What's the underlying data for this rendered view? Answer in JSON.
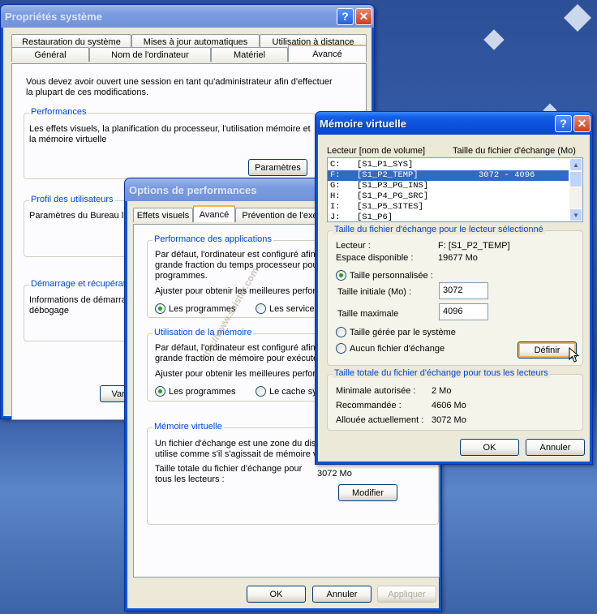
{
  "sys": {
    "title": "Propriétés système",
    "tabs_back": [
      "Restauration du système",
      "Mises à jour automatiques",
      "Utilisation à distance"
    ],
    "tabs_front": [
      "Général",
      "Nom de l'ordinateur",
      "Matériel",
      "Avancé"
    ],
    "intro": [
      "Vous devez avoir ouvert une session en tant qu'administrateur afin d'effectuer",
      "la plupart de ces modifications."
    ],
    "perf_label": "Performances",
    "perf_text": [
      "Les effets visuels, la planification du processeur, l'utilisation mémoire et",
      "la mémoire virtuelle"
    ],
    "perf_btn": "Paramètres",
    "profile_label": "Profil des utilisateurs",
    "profile_text": "Paramètres du Bureau lié",
    "startup_label": "Démarrage et récupératio",
    "startup_text": [
      "Informations de démarrag",
      "débogage"
    ],
    "var_btn": "Variab"
  },
  "perf": {
    "title": "Options de performances",
    "tabs": [
      "Effets visuels",
      "Avancé",
      "Prévention de l'exé"
    ],
    "app_label": "Performance des applications",
    "app_text": [
      "Par défaut, l'ordinateur est configuré afin",
      "grande fraction du temps processeur pour",
      "programmes."
    ],
    "app_adjust": "Ajuster pour obtenir les meilleures perform",
    "app_opt1": "Les programmes",
    "app_opt2": "Les services",
    "mem_label": "Utilisation de la mémoire",
    "mem_text": [
      "Par défaut, l'ordinateur est configuré afin",
      "grande fraction de mémoire pour exécuter"
    ],
    "mem_adjust": "Ajuster pour obtenir les meilleures perform",
    "mem_opt1": "Les programmes",
    "mem_opt2": "Le cache sys",
    "vm_label": "Mémoire virtuelle",
    "vm_text": [
      "Un fichier d'échange est une zone du disqu",
      "utilise comme s'il s'agissait de mémoire viv"
    ],
    "vm_total_label": [
      "Taille totale du fichier d'échange pour",
      "tous les lecteurs :"
    ],
    "vm_total_value": "3072 Mo",
    "modify_btn": "Modifier",
    "ok": "OK",
    "cancel": "Annuler",
    "apply": "Appliquer"
  },
  "vm": {
    "title": "Mémoire virtuelle",
    "col_drive": "Lecteur [nom de volume]",
    "col_size": "Taille du fichier d'échange (Mo)",
    "drives": [
      {
        "letter": "C:",
        "name": "[S1_P1_SYS]",
        "size": ""
      },
      {
        "letter": "F:",
        "name": "[S1_P2_TEMP]",
        "size": "3072 - 4096"
      },
      {
        "letter": "G:",
        "name": "[S1_P3_PG_INS]",
        "size": ""
      },
      {
        "letter": "H:",
        "name": "[S1_P4_PG_SRC]",
        "size": ""
      },
      {
        "letter": "I:",
        "name": "[S1_P5_SITES]",
        "size": ""
      },
      {
        "letter": "J:",
        "name": "[S1_P6]",
        "size": ""
      }
    ],
    "sel_label": "Taille du fichier d'échange pour le lecteur sélectionné",
    "drive_label": "Lecteur :",
    "drive_value": "F:  [S1_P2_TEMP]",
    "space_label": "Espace disponible :",
    "space_value": "19677 Mo",
    "custom": "Taille personnalisée :",
    "initial_label": "Taille initiale (Mo) :",
    "initial_value": "3072",
    "max_label": "Taille maximale",
    "max_value": "4096",
    "managed": "Taille gérée par le système",
    "none": "Aucun fichier d'échange",
    "define_btn": "Définir",
    "total_label": "Taille totale du fichier d'échange pour tous les lecteurs",
    "min_label": "Minimale autorisée :",
    "min_value": "2 Mo",
    "rec_label": "Recommandée :",
    "rec_value": "4606 Mo",
    "alloc_label": "Allouée actuellement :",
    "alloc_value": "3072 Mo",
    "ok": "OK",
    "cancel": "Annuler"
  },
  "watermark": "http://www.ssister.com"
}
